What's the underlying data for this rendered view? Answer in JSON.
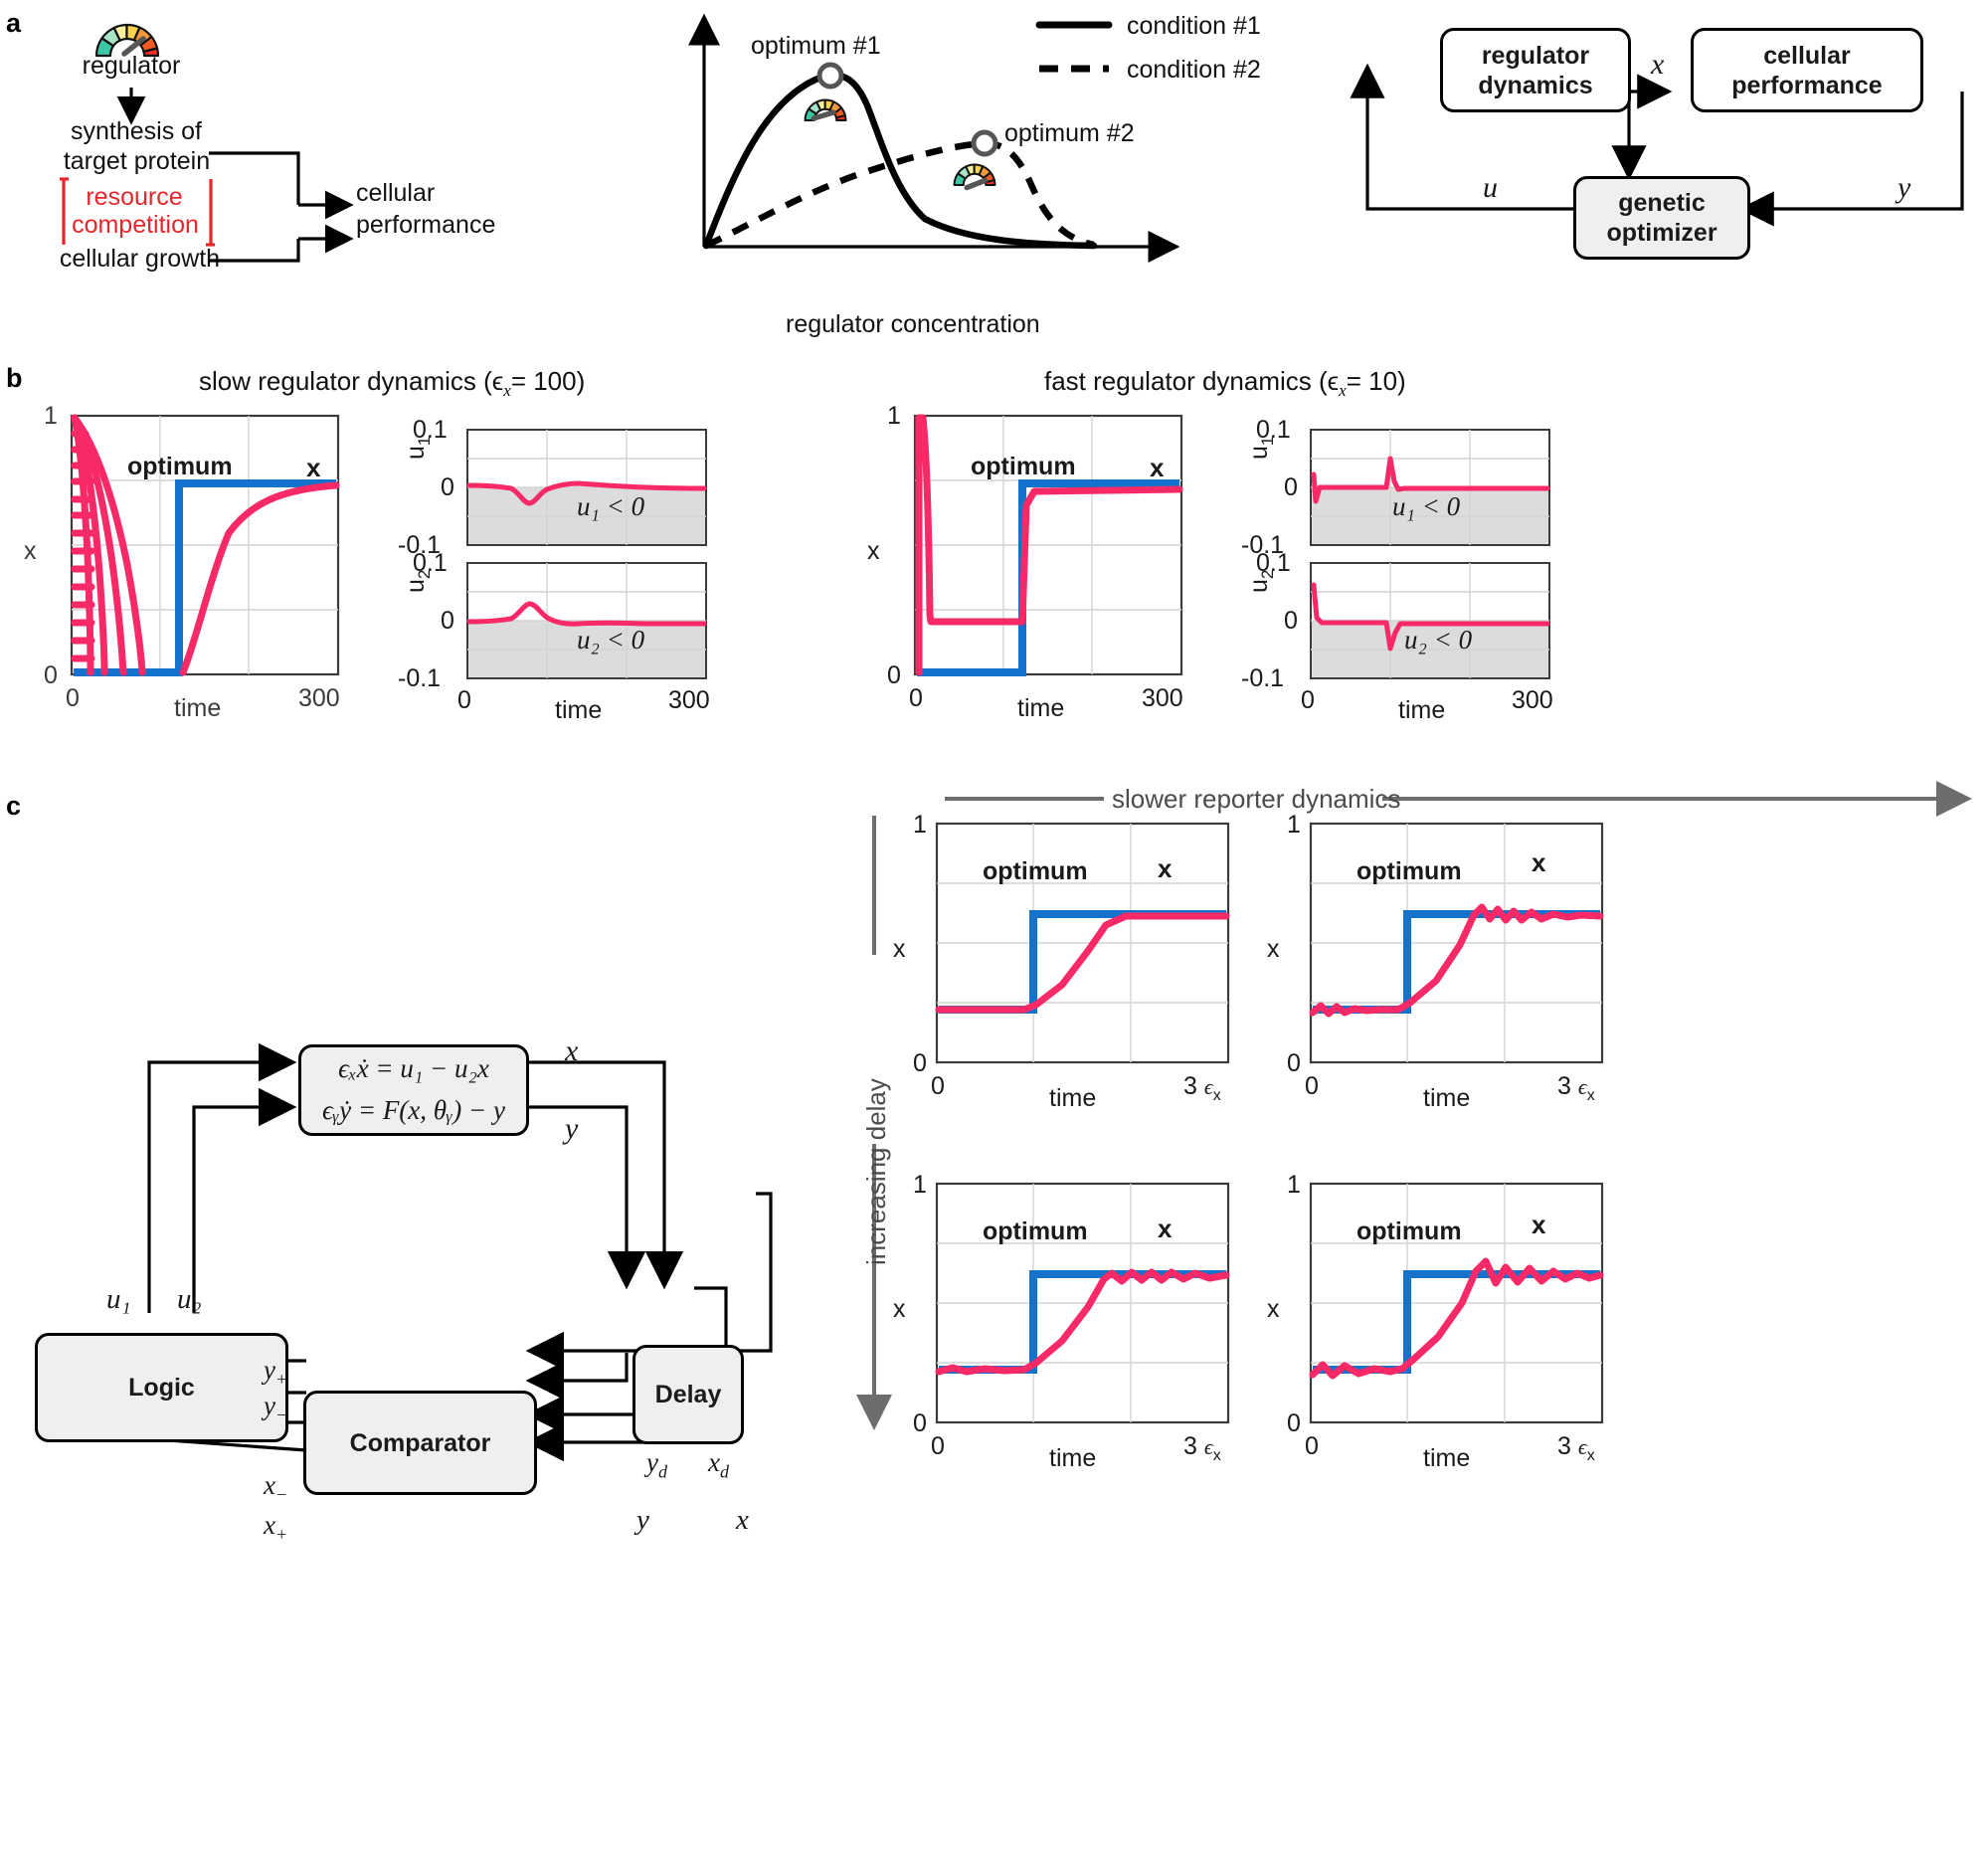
{
  "panels": {
    "a": "a",
    "b": "b",
    "c": "c"
  },
  "panel_a": {
    "left_flow": {
      "regulator_icon": "gauge-icon",
      "regulator": "regulator",
      "synthesis_line1": "synthesis of",
      "synthesis_line2": "target protein",
      "resource_line1": "resource",
      "resource_line2": "competition",
      "growth": "cellular growth",
      "performance_line1": "cellular",
      "performance_line2": "performance",
      "resource_color": "#e8252a"
    },
    "middle_plot": {
      "ylabel": "cellular performance",
      "xlabel": "regulator concentration",
      "opt1": "optimum #1",
      "opt2": "optimum #2",
      "legend": [
        {
          "label": "condition #1",
          "style": "solid"
        },
        {
          "label": "condition #2",
          "style": "dashed"
        }
      ]
    },
    "block_diagram": {
      "regulator_dynamics_line1": "regulator",
      "regulator_dynamics_line2": "dynamics",
      "cellular_performance_line1": "cellular",
      "cellular_performance_line2": "performance",
      "genetic_optimizer_line1": "genetic",
      "genetic_optimizer_line2": "optimizer",
      "signal_x": "x",
      "signal_u": "u",
      "signal_y": "y"
    }
  },
  "panel_b": {
    "title_left": "slow regulator dynamics (ϵ",
    "title_left_sub": "x",
    "title_left_end": "= 100)",
    "title_right": "fast regulator dynamics (ϵ",
    "title_right_sub": "x",
    "title_right_end": "= 10)",
    "x_axis_label": "time",
    "x_tick_min": "0",
    "x_tick_max": "300",
    "x_ylabel": "x",
    "x_ytick_top": "1",
    "x_ytick_bottom": "0",
    "u1_label": "u",
    "u1_sub": "1",
    "u2_label": "u",
    "u2_sub": "2",
    "u_ytick_top": "0.1",
    "u_ytick_mid": "0",
    "u_ytick_bottom": "-0.1",
    "u1_region": "u₁ < 0",
    "u2_region": "u₂ < 0",
    "optimum": "optimum",
    "x_trace": "x"
  },
  "panel_c": {
    "equations": {
      "eq1": "ϵₓẋ = u₁ − u₂x",
      "eq2": "ϵᵧẏ = F(x, θᵧ) − y"
    },
    "blocks": {
      "logic": "Logic",
      "delay": "Delay",
      "comparator": "Comparator"
    },
    "signals": {
      "u1": "u₁",
      "u2": "u₂",
      "x": "x",
      "y": "y",
      "yd": "y_d",
      "xd": "x_d",
      "y_plus": "y₊",
      "y_minus": "y₋",
      "x_minus": "x₋",
      "x_plus": "x₊"
    },
    "right_grid": {
      "top_arrow_label": "slower reporter dynamics",
      "left_arrow_label": "increasing delay",
      "optimum": "optimum",
      "x_trace": "x",
      "ylabel": "x",
      "ytick_top": "1",
      "ytick_bottom": "0",
      "xlabel": "time",
      "xtick_min": "0",
      "xtick_max": "3",
      "xtick_max_unit": "ϵ",
      "xtick_max_sub": "x"
    }
  },
  "chart_data": [
    {
      "id": "panel-a-performance-curve",
      "type": "line",
      "title": "",
      "xlabel": "regulator concentration",
      "ylabel": "cellular performance",
      "series": [
        {
          "name": "condition #1",
          "style": "solid",
          "x": [
            0,
            0.06,
            0.14,
            0.24,
            0.33,
            0.4,
            0.46,
            0.52,
            0.6,
            0.7,
            0.82,
            0.92,
            1.0
          ],
          "y": [
            0.0,
            0.36,
            0.62,
            0.8,
            0.9,
            0.93,
            0.88,
            0.72,
            0.45,
            0.25,
            0.12,
            0.06,
            0.03
          ]
        },
        {
          "name": "condition #2",
          "style": "dashed",
          "x": [
            0,
            0.1,
            0.22,
            0.34,
            0.46,
            0.56,
            0.64,
            0.7,
            0.76,
            0.84,
            0.92,
            1.0
          ],
          "y": [
            0.0,
            0.17,
            0.32,
            0.44,
            0.55,
            0.62,
            0.66,
            0.67,
            0.62,
            0.4,
            0.16,
            0.03
          ]
        }
      ],
      "annotations": [
        {
          "label": "optimum #1",
          "x": 0.4,
          "y": 0.93
        },
        {
          "label": "optimum #2",
          "x": 0.7,
          "y": 0.67
        }
      ],
      "legend_position": "top-right",
      "grid": false
    },
    {
      "id": "panel-b-slow-x",
      "type": "line",
      "xlabel": "time",
      "ylabel": "x",
      "xlim": [
        0,
        300
      ],
      "ylim": [
        0,
        1
      ],
      "xticks": [
        "0",
        "300"
      ],
      "yticks": [
        "0",
        "1"
      ],
      "grid": true,
      "series": [
        {
          "name": "optimum",
          "color": "#1372cc",
          "x": [
            0,
            120,
            120,
            300
          ],
          "y": [
            0,
            0,
            0.78,
            0.78
          ]
        },
        {
          "name": "x",
          "color": "#f72a67",
          "x": [
            0,
            3,
            10,
            22,
            40,
            55,
            70,
            90,
            110,
            120,
            135,
            155,
            180,
            210,
            245,
            280,
            300
          ],
          "y": [
            0,
            1.0,
            0.93,
            0.62,
            0.26,
            0.12,
            0.1,
            0.1,
            0.1,
            0.1,
            0.3,
            0.52,
            0.66,
            0.73,
            0.765,
            0.775,
            0.78
          ]
        }
      ]
    },
    {
      "id": "panel-b-slow-u1",
      "type": "line",
      "xlabel": "time",
      "ylabel": "u1",
      "xlim": [
        0,
        300
      ],
      "ylim": [
        -0.1,
        0.1
      ],
      "yticks": [
        "-0.1",
        "0",
        "0.1"
      ],
      "shaded_region": "u1 < 0",
      "series": [
        {
          "name": "u1",
          "color": "#f72a67",
          "x": [
            0,
            20,
            45,
            60,
            70,
            80,
            95,
            110,
            125,
            140,
            170,
            220,
            300
          ],
          "y": [
            0.004,
            0.002,
            -0.002,
            -0.018,
            -0.03,
            -0.016,
            -0.004,
            0.004,
            0.006,
            0.001,
            -0.002,
            -0.002,
            -0.002
          ]
        }
      ]
    },
    {
      "id": "panel-b-slow-u2",
      "type": "line",
      "xlabel": "time",
      "ylabel": "u2",
      "xlim": [
        0,
        300
      ],
      "ylim": [
        -0.1,
        0.1
      ],
      "yticks": [
        "-0.1",
        "0",
        "0.1"
      ],
      "shaded_region": "u2 < 0",
      "series": [
        {
          "name": "u2",
          "color": "#f72a67",
          "x": [
            0,
            20,
            45,
            62,
            72,
            82,
            95,
            115,
            130,
            150,
            190,
            250,
            300
          ],
          "y": [
            0.002,
            0.002,
            0.006,
            0.022,
            0.03,
            0.012,
            0.002,
            -0.004,
            0.002,
            -0.002,
            -0.003,
            -0.003,
            -0.003
          ]
        }
      ]
    },
    {
      "id": "panel-b-fast-x",
      "type": "line",
      "xlabel": "time",
      "ylabel": "x",
      "xlim": [
        0,
        300
      ],
      "ylim": [
        0,
        1
      ],
      "xticks": [
        "0",
        "300"
      ],
      "yticks": [
        "0",
        "1"
      ],
      "grid": true,
      "series": [
        {
          "name": "optimum",
          "color": "#1372cc",
          "x": [
            0,
            120,
            120,
            300
          ],
          "y": [
            0,
            0,
            0.78,
            0.78
          ]
        },
        {
          "name": "x",
          "color": "#f72a67",
          "x": [
            0,
            2,
            4,
            8,
            12,
            118,
            120,
            123,
            300
          ],
          "y": [
            0,
            1.0,
            0.55,
            0.22,
            0.2,
            0.2,
            0.2,
            0.76,
            0.76
          ]
        }
      ]
    },
    {
      "id": "panel-b-fast-u1",
      "type": "line",
      "xlabel": "time",
      "ylabel": "u1",
      "xlim": [
        0,
        300
      ],
      "ylim": [
        -0.1,
        0.1
      ],
      "shaded_region": "u1 < 0",
      "series": [
        {
          "name": "u1",
          "color": "#f72a67",
          "x": [
            0,
            6,
            14,
            25,
            60,
            112,
            118,
            124,
            132,
            145,
            200,
            300
          ],
          "y": [
            0.02,
            -0.025,
            -0.004,
            0.0,
            0.0,
            0.0,
            0.055,
            0.01,
            -0.005,
            -0.002,
            -0.002,
            -0.002
          ]
        }
      ]
    },
    {
      "id": "panel-b-fast-u2",
      "type": "line",
      "xlabel": "time",
      "ylabel": "u2",
      "xlim": [
        0,
        300
      ],
      "ylim": [
        -0.1,
        0.1
      ],
      "shaded_region": "u2 < 0",
      "series": [
        {
          "name": "u2",
          "color": "#f72a67",
          "x": [
            0,
            5,
            12,
            25,
            60,
            112,
            120,
            128,
            140,
            170,
            240,
            300
          ],
          "y": [
            0.06,
            0.01,
            -0.004,
            -0.002,
            -0.002,
            -0.002,
            -0.038,
            -0.008,
            -0.003,
            -0.003,
            -0.003,
            -0.003
          ]
        }
      ]
    },
    {
      "id": "panel-c-grid-1-1",
      "type": "line",
      "xlabel": "time",
      "ylabel": "x",
      "xlim": [
        0,
        3
      ],
      "ylim": [
        0,
        1
      ],
      "xticks": [
        "0",
        "3 ϵx"
      ],
      "yticks": [
        "0",
        "1"
      ],
      "grid": true,
      "series": [
        {
          "name": "optimum",
          "color": "#1372cc",
          "x": [
            0,
            1.0,
            1.0,
            3.0
          ],
          "y": [
            0.22,
            0.22,
            0.62,
            0.62
          ]
        },
        {
          "name": "x",
          "color": "#f72a67",
          "x": [
            0,
            0.9,
            1.05,
            1.3,
            1.55,
            1.75,
            2.0,
            3.0
          ],
          "y": [
            0.22,
            0.22,
            0.26,
            0.4,
            0.54,
            0.61,
            0.62,
            0.62
          ]
        }
      ],
      "oscillation_amplitude": 0.005
    },
    {
      "id": "panel-c-grid-1-2",
      "type": "line",
      "xlabel": "time",
      "ylabel": "x",
      "xlim": [
        0,
        3
      ],
      "ylim": [
        0,
        1
      ],
      "xticks": [
        "0",
        "3 ϵx"
      ],
      "yticks": [
        "0",
        "1"
      ],
      "grid": true,
      "series": [
        {
          "name": "optimum",
          "color": "#1372cc",
          "x": [
            0,
            1.0,
            1.0,
            3.0
          ],
          "y": [
            0.22,
            0.22,
            0.62,
            0.62
          ]
        },
        {
          "name": "x",
          "color": "#f72a67",
          "x": [
            0,
            0.9,
            1.05,
            1.3,
            1.55,
            1.75,
            2.0,
            3.0
          ],
          "y": [
            0.22,
            0.22,
            0.26,
            0.4,
            0.56,
            0.64,
            0.63,
            0.62
          ]
        }
      ],
      "oscillation_amplitude": 0.03
    },
    {
      "id": "panel-c-grid-2-1",
      "type": "line",
      "xlabel": "time",
      "ylabel": "x",
      "xlim": [
        0,
        3
      ],
      "ylim": [
        0,
        1
      ],
      "xticks": [
        "0",
        "3 ϵx"
      ],
      "yticks": [
        "0",
        "1"
      ],
      "grid": true,
      "series": [
        {
          "name": "optimum",
          "color": "#1372cc",
          "x": [
            0,
            1.0,
            1.0,
            3.0
          ],
          "y": [
            0.22,
            0.22,
            0.62,
            0.62
          ]
        },
        {
          "name": "x",
          "color": "#f72a67",
          "x": [
            0,
            0.9,
            1.05,
            1.3,
            1.55,
            1.75,
            2.0,
            3.0
          ],
          "y": [
            0.22,
            0.22,
            0.26,
            0.4,
            0.55,
            0.62,
            0.62,
            0.62
          ]
        }
      ],
      "oscillation_amplitude": 0.018
    },
    {
      "id": "panel-c-grid-2-2",
      "type": "line",
      "xlabel": "time",
      "ylabel": "x",
      "xlim": [
        0,
        3
      ],
      "ylim": [
        0,
        1
      ],
      "xticks": [
        "0",
        "3 ϵx"
      ],
      "yticks": [
        "0",
        "1"
      ],
      "grid": true,
      "series": [
        {
          "name": "optimum",
          "color": "#1372cc",
          "x": [
            0,
            1.0,
            1.0,
            3.0
          ],
          "y": [
            0.22,
            0.22,
            0.62,
            0.62
          ]
        },
        {
          "name": "x",
          "color": "#f72a67",
          "x": [
            0,
            0.9,
            1.05,
            1.3,
            1.55,
            1.8,
            2.1,
            3.0
          ],
          "y": [
            0.22,
            0.22,
            0.26,
            0.4,
            0.56,
            0.64,
            0.63,
            0.62
          ]
        }
      ],
      "oscillation_amplitude": 0.035
    }
  ]
}
